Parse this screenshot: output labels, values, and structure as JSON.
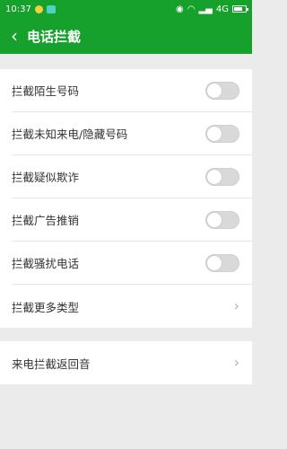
{
  "status": {
    "time": "10:37",
    "network": "4G"
  },
  "header": {
    "back_icon": "back-arrow-icon",
    "title": "电话拦截"
  },
  "settings": [
    {
      "label": "拦截陌生号码",
      "control": "toggle",
      "on": false
    },
    {
      "label": "拦截未知来电/隐藏号码",
      "control": "toggle",
      "on": false
    },
    {
      "label": "拦截疑似欺诈",
      "control": "toggle",
      "on": false
    },
    {
      "label": "拦截广告推销",
      "control": "toggle",
      "on": false
    },
    {
      "label": "拦截骚扰电话",
      "control": "toggle",
      "on": false
    },
    {
      "label": "拦截更多类型",
      "control": "chevron"
    }
  ],
  "more": [
    {
      "label": "来电拦截返回音",
      "control": "chevron"
    }
  ],
  "colors": {
    "accent": "#16a02c",
    "background": "#ebebeb"
  }
}
